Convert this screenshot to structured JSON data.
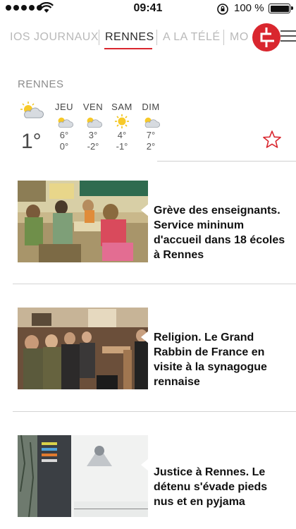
{
  "status": {
    "time": "09:41",
    "battery_label": "100 %",
    "signal_icon": "signal-dots-icon",
    "wifi_icon": "wifi-icon",
    "lock_icon": "rotation-lock-icon",
    "battery_icon": "battery-icon",
    "battery_level": 1.0
  },
  "tabs": [
    {
      "label": "IOS JOURNAUX",
      "active": false
    },
    {
      "label": "RENNES",
      "active": true
    },
    {
      "label": "A LA TÉLÉ",
      "active": false
    },
    {
      "label": "MO",
      "active": false
    }
  ],
  "brand": {
    "accent": "#d9262e",
    "logo_icon": "ouest-france-logo-icon",
    "menu_icon": "hamburger-menu-icon"
  },
  "weather": {
    "city": "RENNES",
    "today": {
      "temp": "1°",
      "icon": "partly-cloudy-icon"
    },
    "days": [
      {
        "name": "JEU",
        "icon": "partly-cloudy-icon",
        "hi": "6°",
        "lo": "0°"
      },
      {
        "name": "VEN",
        "icon": "partly-cloudy-icon",
        "hi": "3°",
        "lo": "-2°"
      },
      {
        "name": "SAM",
        "icon": "sunny-icon",
        "hi": "4°",
        "lo": "-1°"
      },
      {
        "name": "DIM",
        "icon": "partly-cloudy-icon",
        "hi": "7°",
        "lo": "2°"
      }
    ],
    "favorite_icon": "star-outline-icon"
  },
  "articles": [
    {
      "headline": "Grève des enseignants. Service mininum d'accueil dans 18 écoles à Rennes",
      "image": "classroom-photo"
    },
    {
      "headline": "Religion. Le Grand Rabbin de France en visite à la synagogue rennaise",
      "image": "synagogue-photo"
    },
    {
      "headline": "Justice à Rennes. Le détenu s'évade pieds nus et en pyjama",
      "image": "hospital-sign-photo"
    }
  ]
}
